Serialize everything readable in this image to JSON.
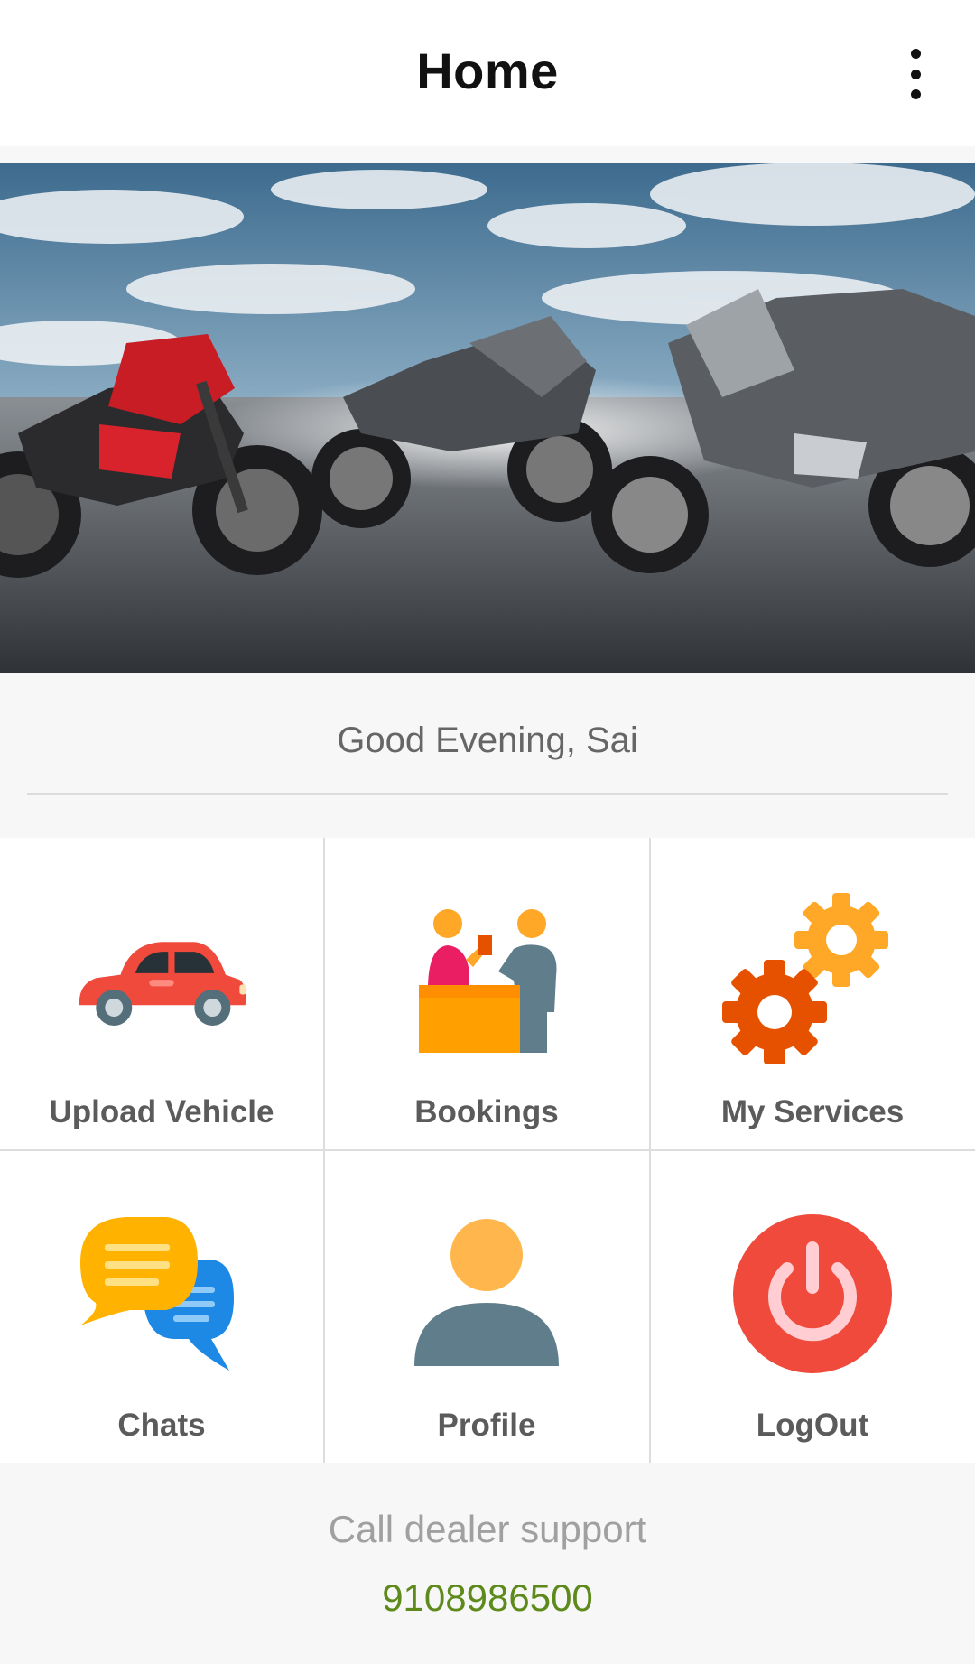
{
  "appbar": {
    "title": "Home",
    "menu_icon": "more-vert-icon"
  },
  "hero": {
    "image": "motorcycles-banner"
  },
  "greeting": "Good Evening, Sai",
  "tiles": [
    {
      "label": "Upload Vehicle",
      "icon": "car-icon"
    },
    {
      "label": "Bookings",
      "icon": "reception-desk-icon"
    },
    {
      "label": "My Services",
      "icon": "gears-icon"
    },
    {
      "label": "Chats",
      "icon": "chat-bubbles-icon"
    },
    {
      "label": "Profile",
      "icon": "person-icon"
    },
    {
      "label": "LogOut",
      "icon": "power-icon"
    }
  ],
  "support": {
    "label": "Call dealer support",
    "phone": "9108986500"
  },
  "colors": {
    "phone": "#5d8a1b",
    "car": "#ef4a3c",
    "gear_orange": "#e65100",
    "gear_yellow": "#ffa726",
    "power": "#ef4a3c"
  }
}
